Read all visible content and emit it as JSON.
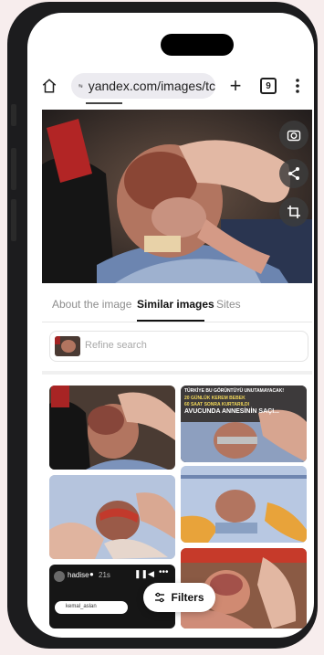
{
  "browser": {
    "url": "yandex.com/images/tc",
    "tab_count": "9"
  },
  "result_tabs": [
    {
      "label": "About the image",
      "active": false
    },
    {
      "label": "Similar images",
      "active": true
    },
    {
      "label": "Sites",
      "active": false
    }
  ],
  "refine": {
    "placeholder": "Refine search"
  },
  "tiles": {
    "news_headline_1": "TÜRKİYE BU GÖRÜNTÜYÜ UNUTAMAYACAK!",
    "news_headline_2": "20 GÜNLÜK KEREM BEBEK",
    "news_headline_3": "60 SAAT SONRA KURTARILDI",
    "news_caption": "AVUCUNDA ANNESİNİN SAÇI...",
    "video_user": "hadise",
    "video_time": "21s",
    "video_subuser": "kemal_aslan"
  },
  "filters_label": "Filters",
  "colors": {
    "accent": "#111111",
    "browser_bg": "#ffffff",
    "url_pill": "#ecebf0"
  }
}
